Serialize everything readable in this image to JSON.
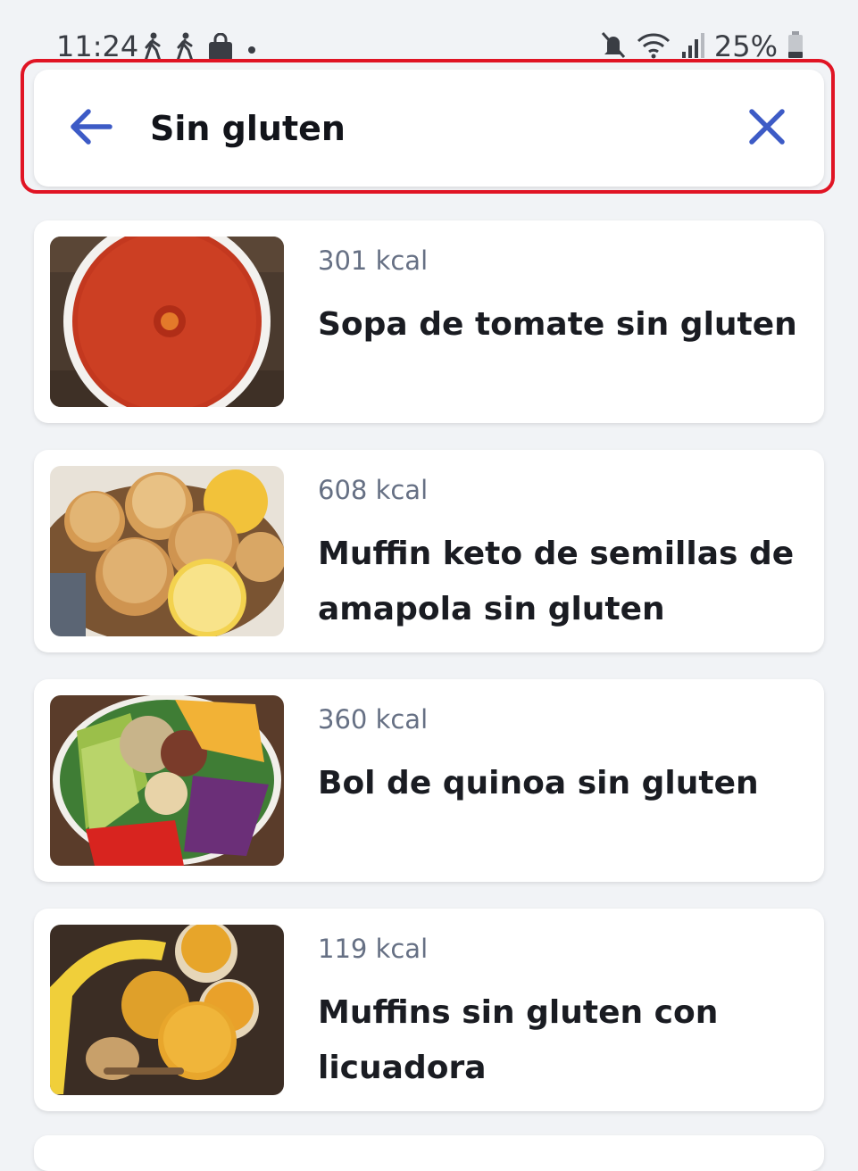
{
  "status_bar": {
    "time": "11:24",
    "battery": "25%",
    "icons": [
      "walking-person-icon",
      "walking-person-icon",
      "shopping-bag-icon",
      "dot-icon",
      "mute-icon",
      "wifi-icon",
      "signal-icon",
      "battery-icon"
    ]
  },
  "search": {
    "query": "Sin gluten",
    "back_icon": "arrow-left-icon",
    "clear_icon": "close-icon",
    "accent_color": "#3d5bc6",
    "highlight_color": "#e01424"
  },
  "results": [
    {
      "kcal": "301 kcal",
      "title": "Sopa de tomate sin gluten",
      "image": "tomato-soup-photo"
    },
    {
      "kcal": "608 kcal",
      "title": "Muffin keto de semillas de amapola sin gluten",
      "image": "poppy-seed-muffins-photo"
    },
    {
      "kcal": "360 kcal",
      "title": "Bol de quinoa sin gluten",
      "image": "quinoa-bowl-photo"
    },
    {
      "kcal": "119 kcal",
      "title": "Muffins sin gluten con licuadora",
      "image": "banana-muffins-photo"
    }
  ]
}
